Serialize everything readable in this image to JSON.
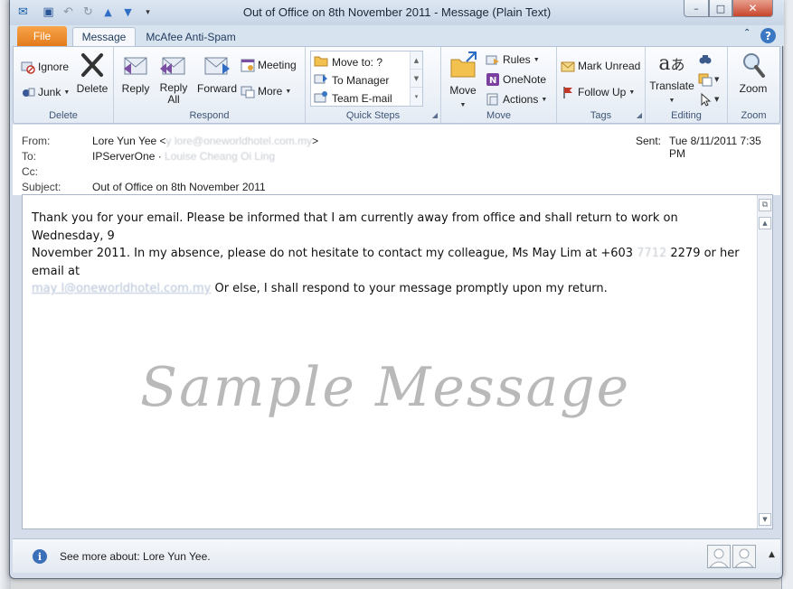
{
  "window": {
    "title": "Out of Office on 8th November 2011  -  Message (Plain Text)",
    "controls": {
      "minimize": "–",
      "maximize": "□",
      "close": "✕"
    }
  },
  "qat": {
    "icons": [
      "outlook-icon",
      "save-icon",
      "undo-icon",
      "redo-icon",
      "previous-item-icon",
      "next-item-icon",
      "customize-qat-icon"
    ]
  },
  "tabs": {
    "file": "File",
    "items": [
      {
        "label": "Message",
        "active": true
      },
      {
        "label": "McAfee Anti-Spam",
        "active": false
      }
    ]
  },
  "ribbon": {
    "groups": {
      "delete": {
        "label": "Delete",
        "ignore": "Ignore",
        "junk": "Junk",
        "delete": "Delete"
      },
      "respond": {
        "label": "Respond",
        "reply": "Reply",
        "reply_all": "Reply All",
        "reply_all_l1": "Reply",
        "reply_all_l2": "All",
        "forward": "Forward",
        "meeting": "Meeting",
        "more": "More"
      },
      "quick_steps": {
        "label": "Quick Steps",
        "items": [
          "Move to: ?",
          "To Manager",
          "Team E-mail"
        ]
      },
      "move": {
        "label": "Move",
        "move": "Move",
        "rules": "Rules",
        "onenote": "OneNote",
        "actions": "Actions"
      },
      "tags": {
        "label": "Tags",
        "mark_unread": "Mark Unread",
        "follow_up": "Follow Up"
      },
      "editing": {
        "label": "Editing",
        "translate": "Translate"
      },
      "zoom": {
        "label": "Zoom",
        "zoom": "Zoom"
      }
    }
  },
  "header": {
    "from_label": "From:",
    "from_name": "Lore Yun Yee <",
    "from_email": "y  lore@oneworldhotel.com.my",
    "from_close": ">",
    "to_label": "To:",
    "to_value": "IPServerOne ·",
    "to_blurred": " Louise Cheang Oi Ling ",
    "cc_label": "Cc:",
    "subject_label": "Subject:",
    "subject_value": "Out of Office on 8th November 2011",
    "sent_label": "Sent:",
    "sent_value": "Tue 8/11/2011 7:35 PM"
  },
  "message": {
    "line1": "Thank you for your email. Please be informed that I am currently away from office and shall return to work on Wednesday, 9",
    "line2a": "November 2011. In my absence, please do not hesitate to contact my colleague, Ms May Lim at +603",
    "line2_blurred": " 7712",
    "line2b": " 2279 or her email at",
    "line3_email": "may  l@oneworldhotel.com.my",
    "line3b": " Or else, I shall respond to your message promptly upon my return.",
    "watermark": "Sample Message"
  },
  "people_pane": {
    "text": "See more about: Lore Yun Yee."
  }
}
